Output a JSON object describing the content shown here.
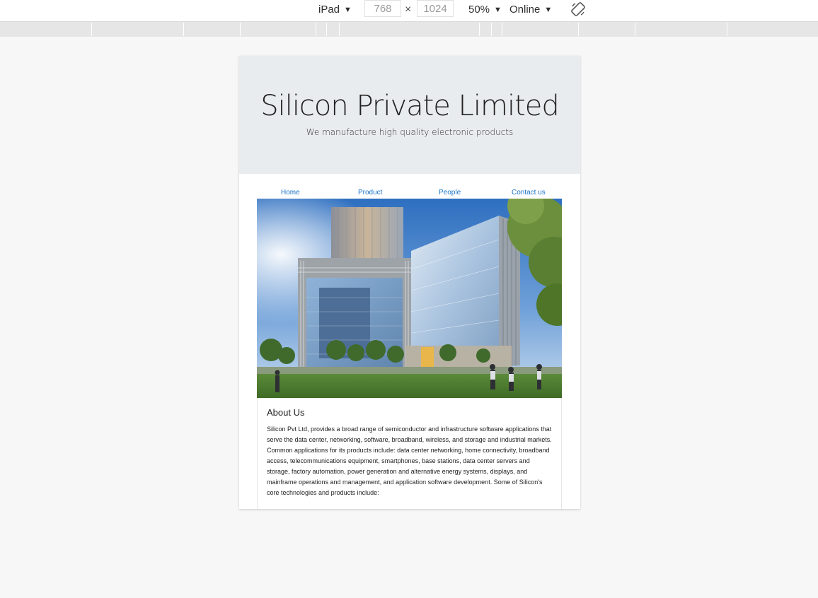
{
  "toolbar": {
    "device": "iPad",
    "width_value": "768",
    "height_value": "1024",
    "times": "×",
    "zoom": "50%",
    "network": "Online",
    "caret": "▼"
  },
  "site": {
    "title": "Silicon Private Limited",
    "tagline": "We manufacture high quality electronic products",
    "nav": [
      "Home",
      "Product",
      "People",
      "Contact us"
    ],
    "about_heading": "About Us",
    "about_text": "Silicon Pvt Ltd, provides a broad range of semiconductor and infrastructure software applications that serve the data center, networking, software, broadband, wireless, and storage and industrial markets. Common applications for its products include: data center networking, home connectivity, broadband access, telecommunications equipment, smartphones, base stations, data center servers and storage, factory automation, power generation and alternative energy systems, displays, and mainframe operations and management, and application software development. Some of Silicon's core technologies and products include:"
  },
  "colors": {
    "accent_link": "#1a73c8",
    "jumbotron_bg": "#e9ecef"
  },
  "icons": [
    "caret-down-icon",
    "rotate-icon"
  ]
}
